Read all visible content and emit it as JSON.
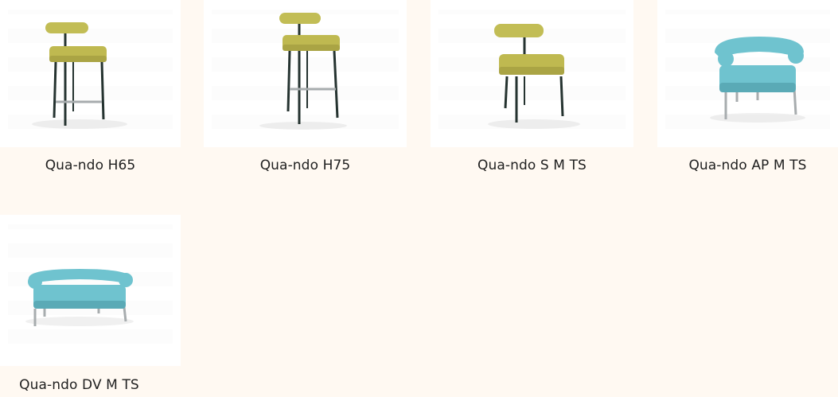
{
  "products": [
    {
      "name": "Qua-ndo H65",
      "kind": "stool-low",
      "fabric_color": "#c2bd55"
    },
    {
      "name": "Qua-ndo H75",
      "kind": "stool-high",
      "fabric_color": "#c2bd55"
    },
    {
      "name": "Qua-ndo S M TS",
      "kind": "chair",
      "fabric_color": "#c2bd55"
    },
    {
      "name": "Qua-ndo AP M TS",
      "kind": "armchair",
      "fabric_color": "#6fc3cf"
    },
    {
      "name": "Qua-ndo DV M TS",
      "kind": "sofa",
      "fabric_color": "#6fc3cf"
    }
  ],
  "colors": {
    "page_background": "#fff9f2",
    "thumb_background": "#ffffff",
    "frame_dark": "#253330",
    "frame_steel": "#a7acae"
  }
}
